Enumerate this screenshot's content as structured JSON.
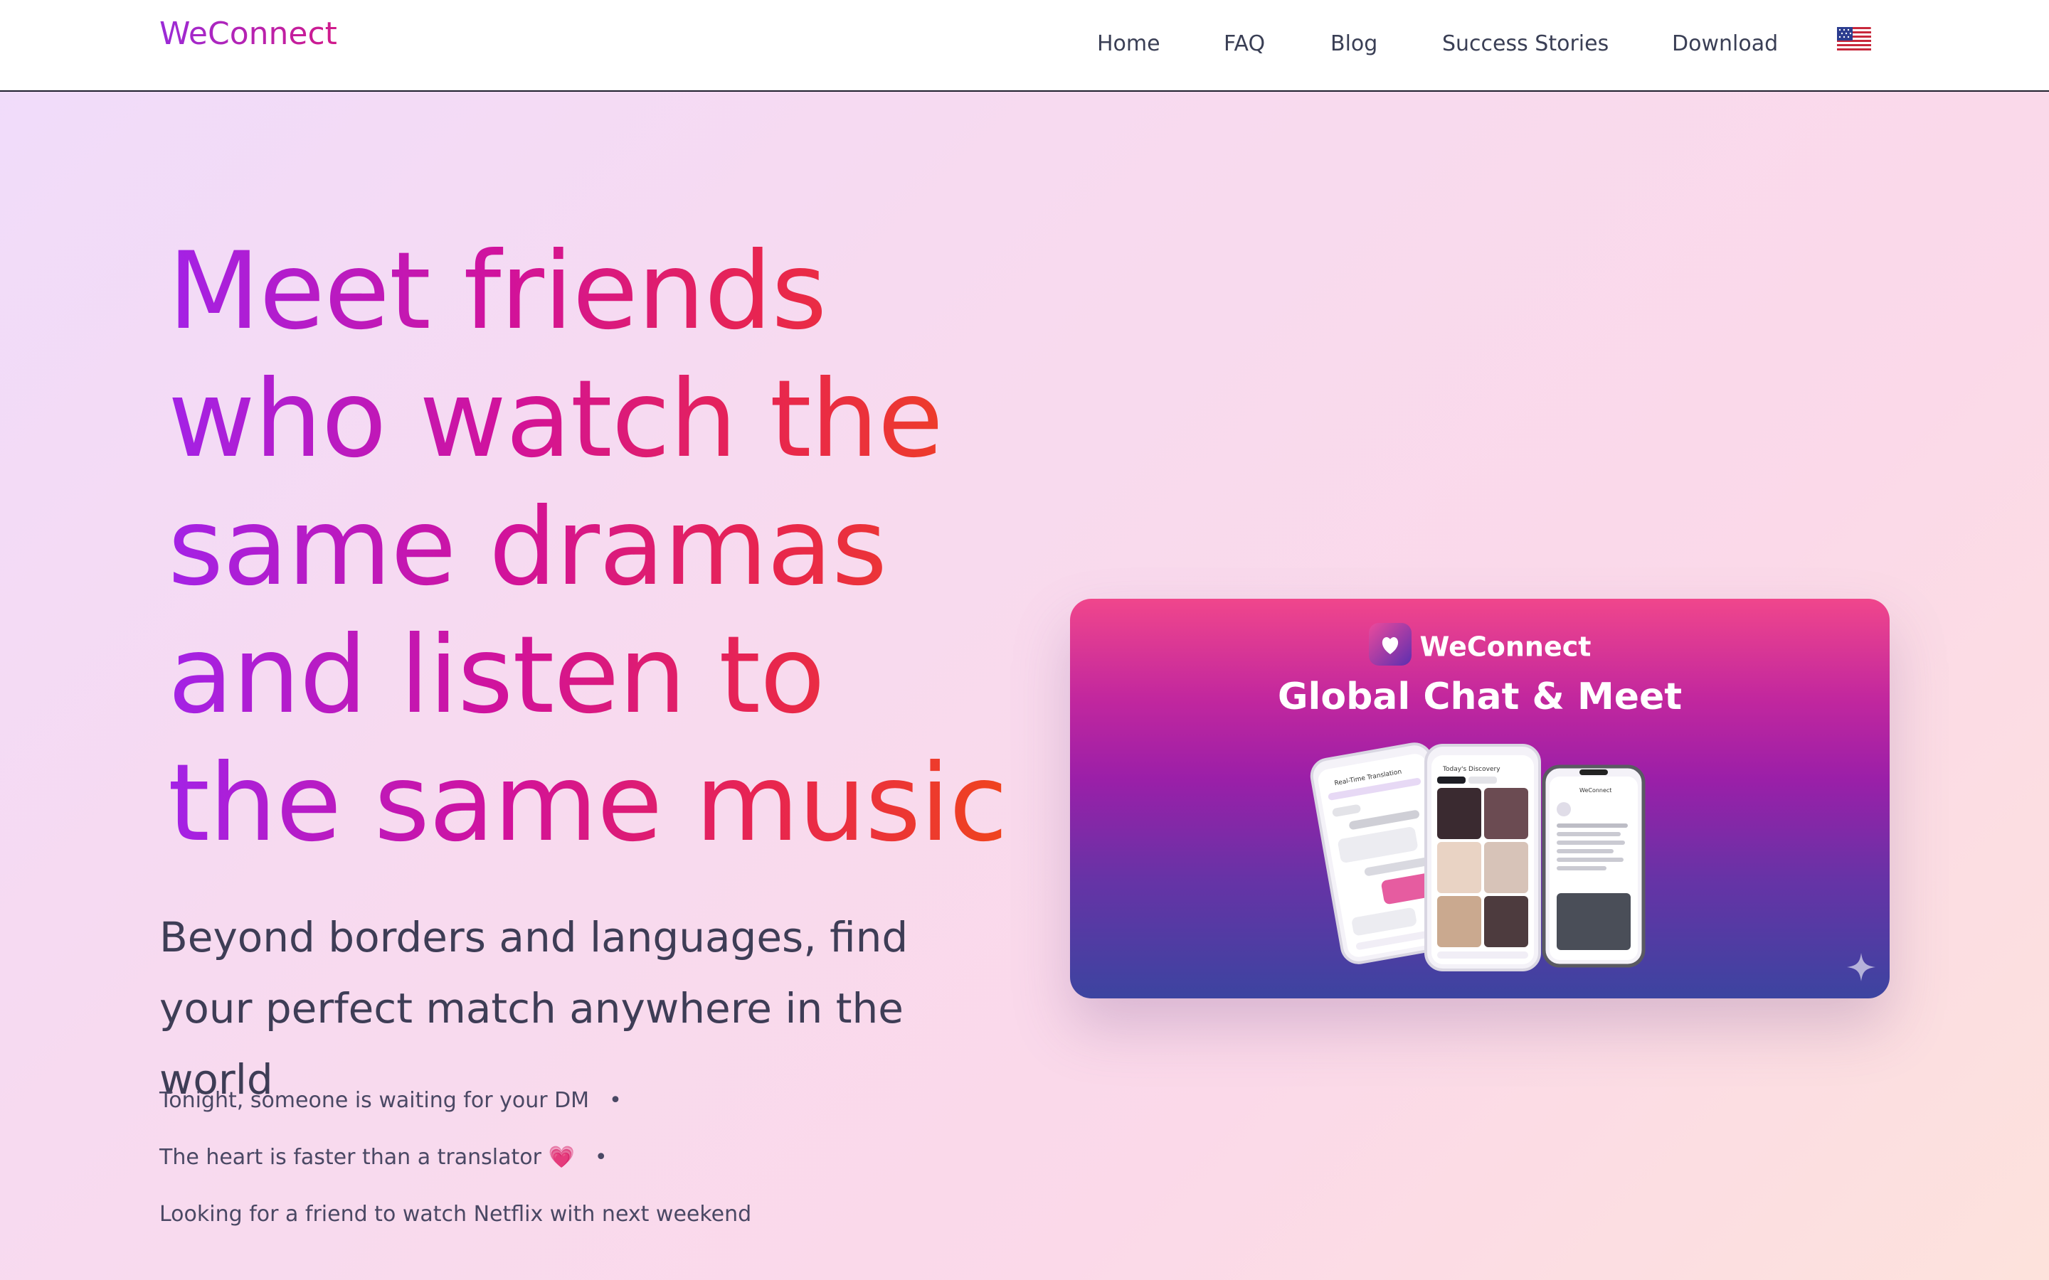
{
  "nav": {
    "logo": "WeConnect",
    "links": [
      "Home",
      "FAQ",
      "Blog",
      "Success Stories",
      "Download"
    ],
    "language_icon": "us-flag-icon"
  },
  "hero": {
    "title": "Meet friends who watch the same dramas and listen to the same music",
    "subtitle": "Beyond borders and languages, find your perfect match anywhere in the world",
    "taglines": [
      "Tonight, someone is waiting for your DM",
      "The heart is faster than a translator 💗",
      "Looking for a friend to watch Netflix with next weekend"
    ],
    "separator": "•"
  },
  "promo": {
    "brand": "WeConnect",
    "heading": "Global Chat & Meet",
    "phone_screens": {
      "left": {
        "title": "Real-Time Translation"
      },
      "middle": {
        "title": "Today's Discovery"
      },
      "right": {
        "title": "WeConnect"
      }
    }
  },
  "colors": {
    "accent_start": "#a322e6",
    "accent_mid": "#d2129a",
    "accent_end": "#f0461a",
    "text": "#3e3d56"
  }
}
